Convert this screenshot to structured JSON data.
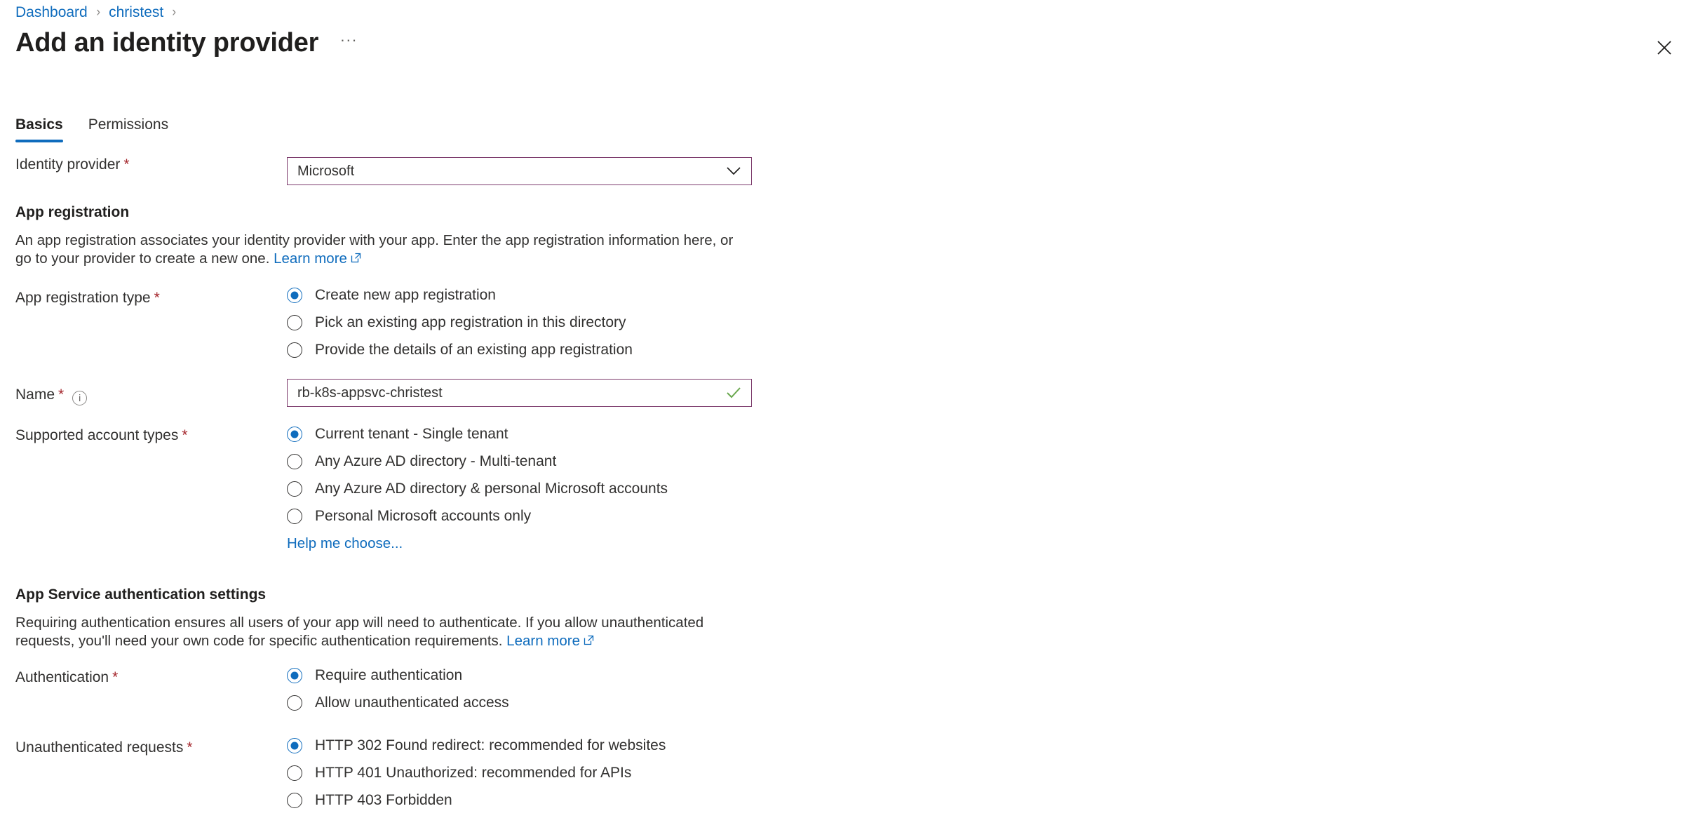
{
  "breadcrumb": {
    "items": [
      {
        "label": "Dashboard"
      },
      {
        "label": "christest"
      }
    ],
    "separator": "›"
  },
  "header": {
    "title": "Add an identity provider",
    "more_label": "···",
    "close_label": "✕"
  },
  "tabs": [
    {
      "label": "Basics",
      "active": true
    },
    {
      "label": "Permissions",
      "active": false
    }
  ],
  "identity_provider": {
    "label": "Identity provider",
    "required_mark": "*",
    "value": "Microsoft",
    "options": [
      "Microsoft"
    ]
  },
  "app_registration": {
    "heading": "App registration",
    "description_part1": "An app registration associates your identity provider with your app. Enter the app registration information here, or go to your provider to create a new one.",
    "learn_more": "Learn more",
    "type": {
      "label": "App registration type",
      "required_mark": "*",
      "options": [
        {
          "label": "Create new app registration",
          "selected": true
        },
        {
          "label": "Pick an existing app registration in this directory",
          "selected": false
        },
        {
          "label": "Provide the details of an existing app registration",
          "selected": false
        }
      ]
    },
    "name": {
      "label": "Name",
      "required_mark": "*",
      "info_glyph": "i",
      "value": "rb-k8s-appsvc-christest",
      "valid": true
    },
    "account_types": {
      "label": "Supported account types",
      "required_mark": "*",
      "options": [
        {
          "label": "Current tenant - Single tenant",
          "selected": true
        },
        {
          "label": "Any Azure AD directory - Multi-tenant",
          "selected": false
        },
        {
          "label": "Any Azure AD directory & personal Microsoft accounts",
          "selected": false
        },
        {
          "label": "Personal Microsoft accounts only",
          "selected": false
        }
      ],
      "help_link": "Help me choose..."
    }
  },
  "auth_settings": {
    "heading": "App Service authentication settings",
    "description_part1": "Requiring authentication ensures all users of your app will need to authenticate. If you allow unauthenticated requests, you'll need your own code for specific authentication requirements.",
    "learn_more": "Learn more",
    "authentication": {
      "label": "Authentication",
      "required_mark": "*",
      "options": [
        {
          "label": "Require authentication",
          "selected": true
        },
        {
          "label": "Allow unauthenticated access",
          "selected": false
        }
      ]
    },
    "unauthenticated_requests": {
      "label": "Unauthenticated requests",
      "required_mark": "*",
      "options": [
        {
          "label": "HTTP 302 Found redirect: recommended for websites",
          "selected": true
        },
        {
          "label": "HTTP 401 Unauthorized: recommended for APIs",
          "selected": false
        },
        {
          "label": "HTTP 403 Forbidden",
          "selected": false
        }
      ]
    }
  },
  "colors": {
    "link": "#0f6cbd",
    "accent": "#0f6cbd",
    "required": "#a4262c",
    "field_border": "#7d3c6d",
    "valid_check": "#6aa84f"
  }
}
